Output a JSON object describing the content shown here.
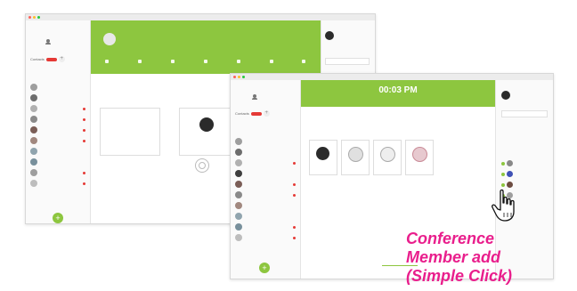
{
  "back_window": {
    "title": "",
    "brand": "",
    "section_label": "Contacts",
    "section_badge": "",
    "caller_name": "",
    "caller_sub": "",
    "contacts": [
      {
        "name": "",
        "sub": ""
      },
      {
        "name": "",
        "sub": ""
      },
      {
        "name": "",
        "sub": ""
      },
      {
        "name": "",
        "sub": ""
      },
      {
        "name": "",
        "sub": ""
      },
      {
        "name": "",
        "sub": ""
      },
      {
        "name": "",
        "sub": ""
      },
      {
        "name": "",
        "sub": ""
      },
      {
        "name": "",
        "sub": ""
      },
      {
        "name": "",
        "sub": ""
      }
    ],
    "left_label": "",
    "right_label": "",
    "add_label": ""
  },
  "front_window": {
    "title": "",
    "brand": "",
    "section_label": "Contacts",
    "call_time": "00:03 PM",
    "call_sub": "",
    "back_label": "",
    "members_label": "",
    "members": [
      {
        "name": ""
      },
      {
        "name": ""
      },
      {
        "name": ""
      },
      {
        "name": ""
      }
    ],
    "contacts": [
      {
        "name": "",
        "sub": ""
      },
      {
        "name": "",
        "sub": ""
      },
      {
        "name": "",
        "sub": ""
      },
      {
        "name": "",
        "sub": ""
      },
      {
        "name": "",
        "sub": ""
      },
      {
        "name": "",
        "sub": ""
      },
      {
        "name": "",
        "sub": ""
      },
      {
        "name": "",
        "sub": ""
      },
      {
        "name": "",
        "sub": ""
      },
      {
        "name": "",
        "sub": ""
      }
    ],
    "right_panel": [
      {
        "name": ""
      },
      {
        "name": ""
      },
      {
        "name": ""
      },
      {
        "name": ""
      },
      {
        "name": ""
      },
      {
        "name": ""
      }
    ]
  },
  "caption": {
    "line1": "Conference",
    "line2": "Member add",
    "line3": "(Simple Click)"
  },
  "colors": {
    "accent_green": "#8dc63f",
    "alert_red": "#e53935",
    "caption_magenta": "#e91e8c"
  }
}
